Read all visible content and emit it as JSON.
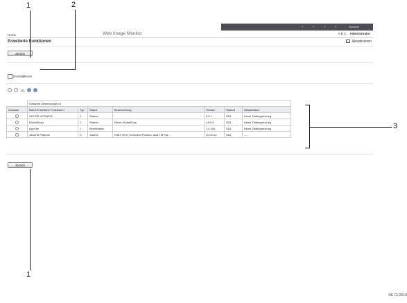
{
  "header": {
    "home": "Home",
    "title": "Web Image Monitor",
    "status_items": [
      "?",
      "?",
      "?",
      "?",
      "Sprache"
    ],
    "user_icons": [
      "A",
      "B",
      "C"
    ],
    "user": "Administrator"
  },
  "page": {
    "title": "Erweiterte Funktionen",
    "refresh": "Aktualisieren",
    "back_top": "Zurück",
    "delete": "Deinstallieren",
    "pager": "1/1",
    "back_bottom": "Zurück"
  },
  "table": {
    "caption": "Gesamte Anwendungen:4",
    "headers": [
      "Auswahl",
      "Name Erweiterte Funktionen",
      "Typ",
      "Status",
      "Beschreibung",
      "Version",
      "Startort",
      "Ablaufdatum"
    ],
    "rows": [
      [
        "SLP-PR VETMP22",
        "J",
        "Starten",
        "",
        "0.0.1",
        "SD1",
        "Keine Zeitbegrenzung"
      ],
      [
        "GlobalScan",
        "J",
        "Starten",
        "Ricoh GlobalScan",
        "v.5.0.0",
        "SD1",
        "Keine Zeitbegrenzung"
      ],
      [
        "AppSite",
        "J",
        "Bereithalten",
        "",
        "1.0.100",
        "SD1",
        "Keine Zeitbegrenzung"
      ],
      [
        "JavaTM Platform",
        "C",
        "Starten",
        "R481 TEST Extended Feature Java TM Pla...",
        "10.01.02",
        "SD1",
        "---"
      ]
    ]
  },
  "callouts": {
    "top_left": "1",
    "top_mid": "2",
    "right": "3",
    "bottom": "1"
  },
  "image_code": "DE CLD010"
}
